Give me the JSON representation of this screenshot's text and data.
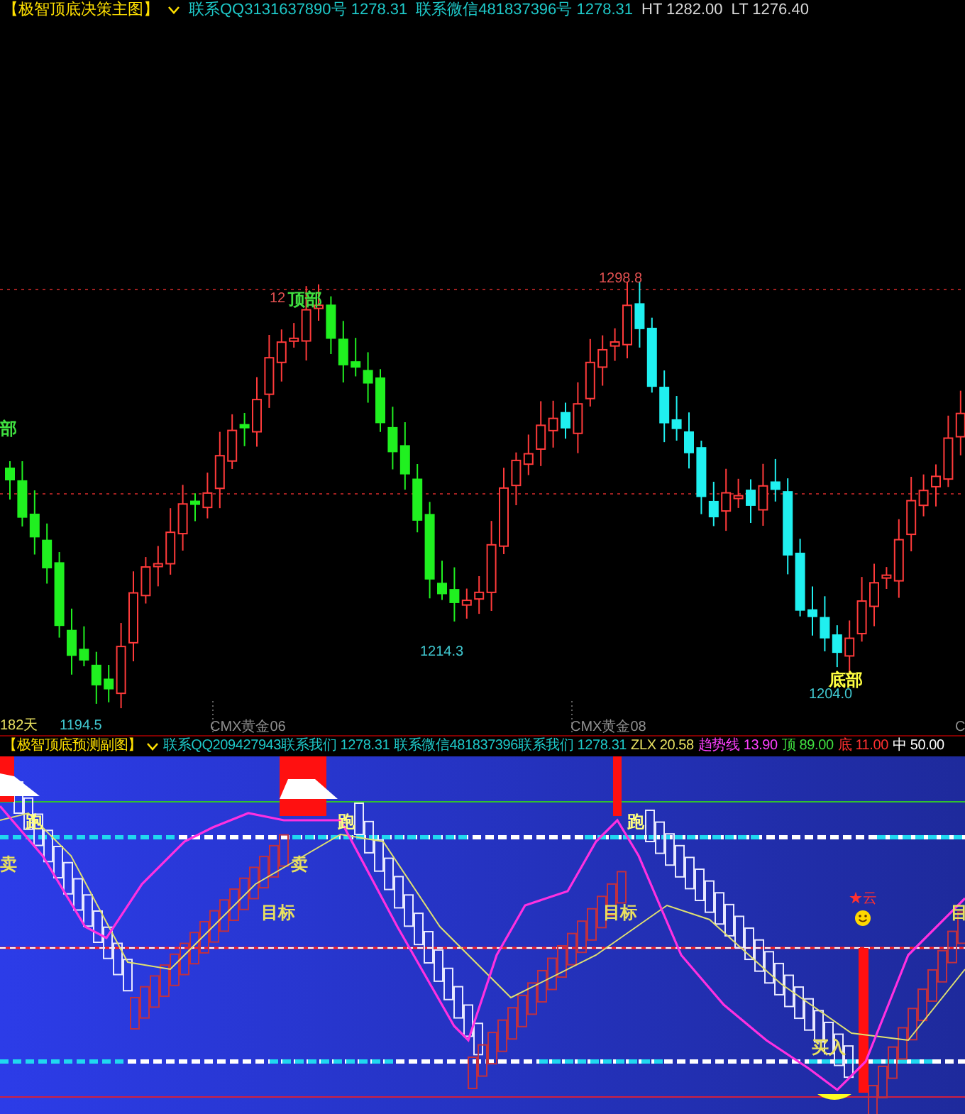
{
  "main_chart": {
    "header": {
      "title": "【极智顶底决策主图】",
      "items": [
        {
          "text": "联系QQ3131637890号 1278.31",
          "color": "#1ec8c8"
        },
        {
          "text": "联系微信481837396号 1278.31",
          "color": "#1ec8c8"
        },
        {
          "text": "HT 1282.00",
          "color": "#d8d8d8"
        },
        {
          "text": "LT 1276.40",
          "color": "#d8d8d8"
        }
      ]
    },
    "labels": [
      {
        "text": "12",
        "color": "#e05050"
      },
      {
        "text": "顶部",
        "color": "#40e040"
      },
      {
        "text": "1298.8",
        "color": "#e05050"
      },
      {
        "text": "部",
        "color": "#40e040"
      },
      {
        "text": "1214.3",
        "color": "#40c8d0"
      },
      {
        "text": "底部",
        "color": "#ffff40"
      },
      {
        "text": "1204.0",
        "color": "#40c8d0"
      },
      {
        "text": "182天",
        "color": "#e8e060"
      },
      {
        "text": "1194.5",
        "color": "#40c8d0"
      },
      {
        "text": "CMX黄金06",
        "color": "#909090"
      },
      {
        "text": "CMX黄金08",
        "color": "#909090"
      },
      {
        "text": "C",
        "color": "#909090"
      }
    ]
  },
  "sub_chart": {
    "header": {
      "title": "【极智顶底预测副图】",
      "items": [
        {
          "text": "联系QQ209427943联系我们 1278.31",
          "color": "#1ec8c8"
        },
        {
          "text": "联系微信481837396联系我们 1278.31",
          "color": "#1ec8c8"
        },
        {
          "text": "ZLX 20.58",
          "color": "#e8e060"
        },
        {
          "text": "趋势线 13.90",
          "color": "#ff40ff"
        },
        {
          "text": "顶 89.00",
          "color": "#40e040"
        },
        {
          "text": "底 11.00",
          "color": "#ff3030"
        },
        {
          "text": "中 50.00",
          "color": "#ffffff"
        }
      ]
    },
    "labels": [
      {
        "text": "跑",
        "color": "#ffff80"
      },
      {
        "text": "跑",
        "color": "#ffff80"
      },
      {
        "text": "跑",
        "color": "#ffff80"
      },
      {
        "text": "卖",
        "color": "#e8e060"
      },
      {
        "text": "卖",
        "color": "#e8e060"
      },
      {
        "text": "目标",
        "color": "#e8e060"
      },
      {
        "text": "目标",
        "color": "#e8e060"
      },
      {
        "text": "目",
        "color": "#e8e060"
      },
      {
        "text": "★云",
        "color": "#ff3030"
      },
      {
        "text": "买入",
        "color": "#e8e060"
      }
    ]
  }
}
